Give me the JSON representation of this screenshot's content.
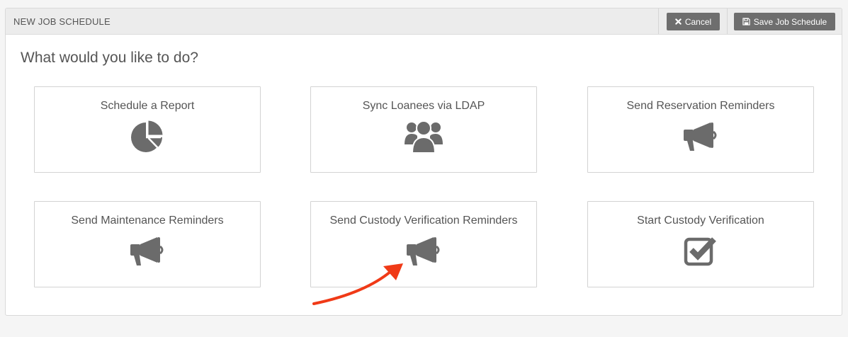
{
  "header": {
    "title": "NEW JOB SCHEDULE",
    "cancel_label": "Cancel",
    "save_label": "Save Job Schedule"
  },
  "question": "What would you like to do?",
  "cards": [
    {
      "label": "Schedule a Report",
      "icon": "pie-chart-icon"
    },
    {
      "label": "Sync Loanees via LDAP",
      "icon": "users-icon"
    },
    {
      "label": "Send Reservation Reminders",
      "icon": "megaphone-icon"
    },
    {
      "label": "Send Maintenance Reminders",
      "icon": "megaphone-icon"
    },
    {
      "label": "Send Custody Verification Reminders",
      "icon": "megaphone-icon"
    },
    {
      "label": "Start Custody Verification",
      "icon": "check-square-icon"
    }
  ],
  "colors": {
    "icon": "#6b6b6b",
    "button": "#6e6e6e",
    "annotation_arrow": "#f03a17"
  }
}
